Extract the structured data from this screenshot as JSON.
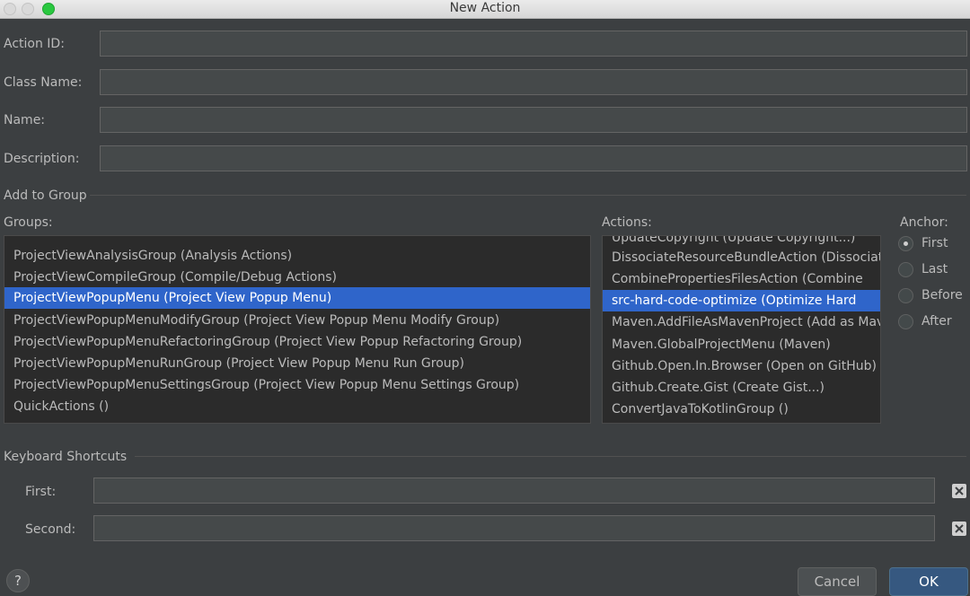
{
  "window": {
    "title": "New Action"
  },
  "form": {
    "action_id_label": "Action ID:",
    "action_id_value": "",
    "class_name_label": "Class Name:",
    "class_name_value": "",
    "name_label": "Name:",
    "name_value": "",
    "description_label": "Description:",
    "description_value": ""
  },
  "add_to_group": {
    "section_label": "Add to Group",
    "groups_label": "Groups:",
    "groups": [
      {
        "label": "ProjectViewAnalysisGroup (Analysis Actions)",
        "selected": false
      },
      {
        "label": "ProjectViewCompileGroup (Compile/Debug Actions)",
        "selected": false
      },
      {
        "label": "ProjectViewPopupMenu (Project View Popup Menu)",
        "selected": true
      },
      {
        "label": "ProjectViewPopupMenuModifyGroup (Project View Popup Menu Modify Group)",
        "selected": false
      },
      {
        "label": "ProjectViewPopupMenuRefactoringGroup (Project View Popup Refactoring Group)",
        "selected": false
      },
      {
        "label": "ProjectViewPopupMenuRunGroup (Project View Popup Menu Run Group)",
        "selected": false
      },
      {
        "label": "ProjectViewPopupMenuSettingsGroup (Project View Popup Menu Settings Group)",
        "selected": false
      },
      {
        "label": "QuickActions ()",
        "selected": false
      }
    ],
    "actions_label": "Actions:",
    "actions": [
      {
        "label": "UpdateCopyright (Update Copyright...)",
        "selected": false
      },
      {
        "label": "DissociateResourceBundleAction (Dissociate",
        "selected": false
      },
      {
        "label": "CombinePropertiesFilesAction (Combine",
        "selected": false
      },
      {
        "label": "src-hard-code-optimize (Optimize Hard",
        "selected": true
      },
      {
        "label": "Maven.AddFileAsMavenProject (Add as Maven",
        "selected": false
      },
      {
        "label": "Maven.GlobalProjectMenu (Maven)",
        "selected": false
      },
      {
        "label": "Github.Open.In.Browser (Open on GitHub)",
        "selected": false
      },
      {
        "label": "Github.Create.Gist (Create Gist...)",
        "selected": false
      },
      {
        "label": "ConvertJavaToKotlinGroup ()",
        "selected": false
      }
    ],
    "anchor_label": "Anchor:",
    "anchor_options": [
      {
        "label": "First",
        "checked": true
      },
      {
        "label": "Last",
        "checked": false
      },
      {
        "label": "Before",
        "checked": false
      },
      {
        "label": "After",
        "checked": false
      }
    ]
  },
  "shortcuts": {
    "section_label": "Keyboard Shortcuts",
    "first_label": "First:",
    "first_value": "",
    "second_label": "Second:",
    "second_value": ""
  },
  "footer": {
    "help_label": "?",
    "cancel_label": "Cancel",
    "ok_label": "OK"
  },
  "colors": {
    "background": "#3c3f41",
    "selection": "#2f65ca",
    "ok_button": "#365880"
  }
}
